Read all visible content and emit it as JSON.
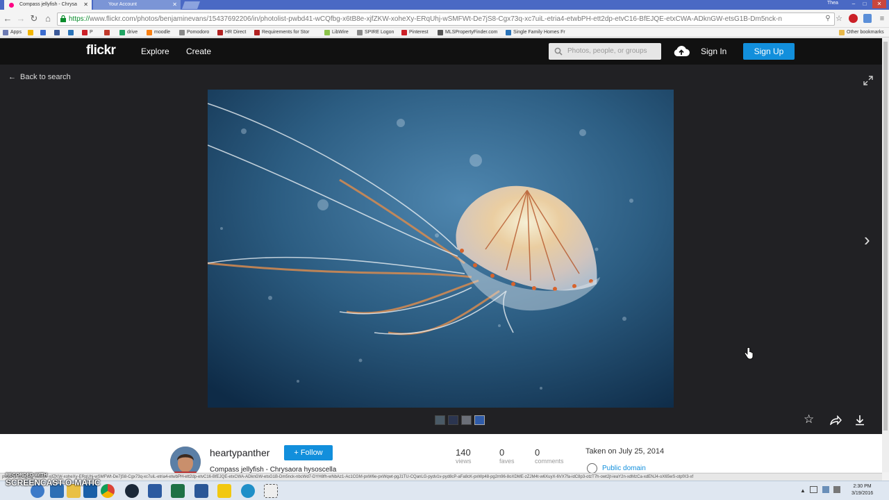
{
  "browser": {
    "tabs": [
      {
        "label": "Compass jellyfish - Chrysa"
      },
      {
        "label": "Your Account"
      }
    ],
    "user": "Thea",
    "url_scheme": "https://",
    "url_rest": "www.flickr.com/photos/benjaminevans/15437692206/in/photolist-pwbd41-wCQfbg-x6tB8e-xjfZKW-xoheXy-ERqUhj-wSMFWt-De7jS8-Cgx73q-xc7uiL-etria4-etwbPH-ett2dp-etvC16-BfEJQE-etxCWA-ADknGW-etsG1B-Dm5nck-n",
    "bookmarks": [
      {
        "label": "Apps",
        "color": "#6d7bb3"
      },
      {
        "label": "",
        "color": "#f2b500"
      },
      {
        "label": "",
        "color": "#3b6ccf"
      },
      {
        "label": "",
        "color": "#3b5998"
      },
      {
        "label": "",
        "color": "#2a73b8"
      },
      {
        "label": "P",
        "color": "#cb2027"
      },
      {
        "label": "",
        "color": "#c0392b"
      },
      {
        "label": "drive",
        "color": "#1fa463"
      },
      {
        "label": "moodle",
        "color": "#f98012"
      },
      {
        "label": "Pomodoro",
        "color": "#888888"
      },
      {
        "label": "HR Direct",
        "color": "#b22222"
      },
      {
        "label": "Requirements for Stor",
        "color": "#b22222"
      },
      {
        "label": "LibWire",
        "color": "#8bc34a"
      },
      {
        "label": "SPIRE Logon",
        "color": "#888888"
      },
      {
        "label": "Pinterest",
        "color": "#cb2027"
      },
      {
        "label": "MLSPropertyFinder.com",
        "color": "#555555"
      },
      {
        "label": "Single Family Homes Fr",
        "color": "#2a73b8"
      },
      {
        "label": "Other bookmarks",
        "color": "#e8b84a"
      }
    ]
  },
  "flickr": {
    "logo": "flickr",
    "nav": [
      "Explore",
      "Create"
    ],
    "search_placeholder": "Photos, people, or groups",
    "sign_in": "Sign In",
    "sign_up": "Sign Up",
    "back": "Back to search"
  },
  "photo": {
    "author": "heartypanther",
    "follow": "+ Follow",
    "title": "Compass jellyfish - Chrysaora hysoscella",
    "stats": [
      {
        "value": "140",
        "label": "views"
      },
      {
        "value": "0",
        "label": "faves"
      },
      {
        "value": "0",
        "label": "comments"
      }
    ],
    "taken": "Taken on July 25, 2014",
    "license": "Public domain"
  },
  "status_url": "pwbd41-wCQfbg-x6tB8e-xjfZKW-xoheXy-ERqUhj-wSMFWt-De7jS8-Cgx73q-xc7uiL-etria4-etwbPH-ett2dp-etvC16-BfEJQE-etxCWA-ADknGW-etsG1B-Dm5nck-nbcWd7-DYH8fh-wNbAz1-Ac1CGM-pxW6e-pxWqwt-pgJ1TU-CQanLG-pydv1v-pyd8cP-aFa8cK-pxWp48-pg2m96-8oXDME-zZJM4t-w6XuyX-6VX7fa-idC8p3-otzT7h-owt2jt-ieaY2n-xdMzCa-xdENJ4-oX65wS-otpfX3-xf",
  "watermark": {
    "top": "RECORDED WITH",
    "main": "SCREENCAST-O-MATIC"
  },
  "clock": {
    "time": "2:30 PM",
    "date": "3/19/2016"
  },
  "colors": {
    "flickr_blue": "#128fdc",
    "page_dark": "#212124"
  }
}
